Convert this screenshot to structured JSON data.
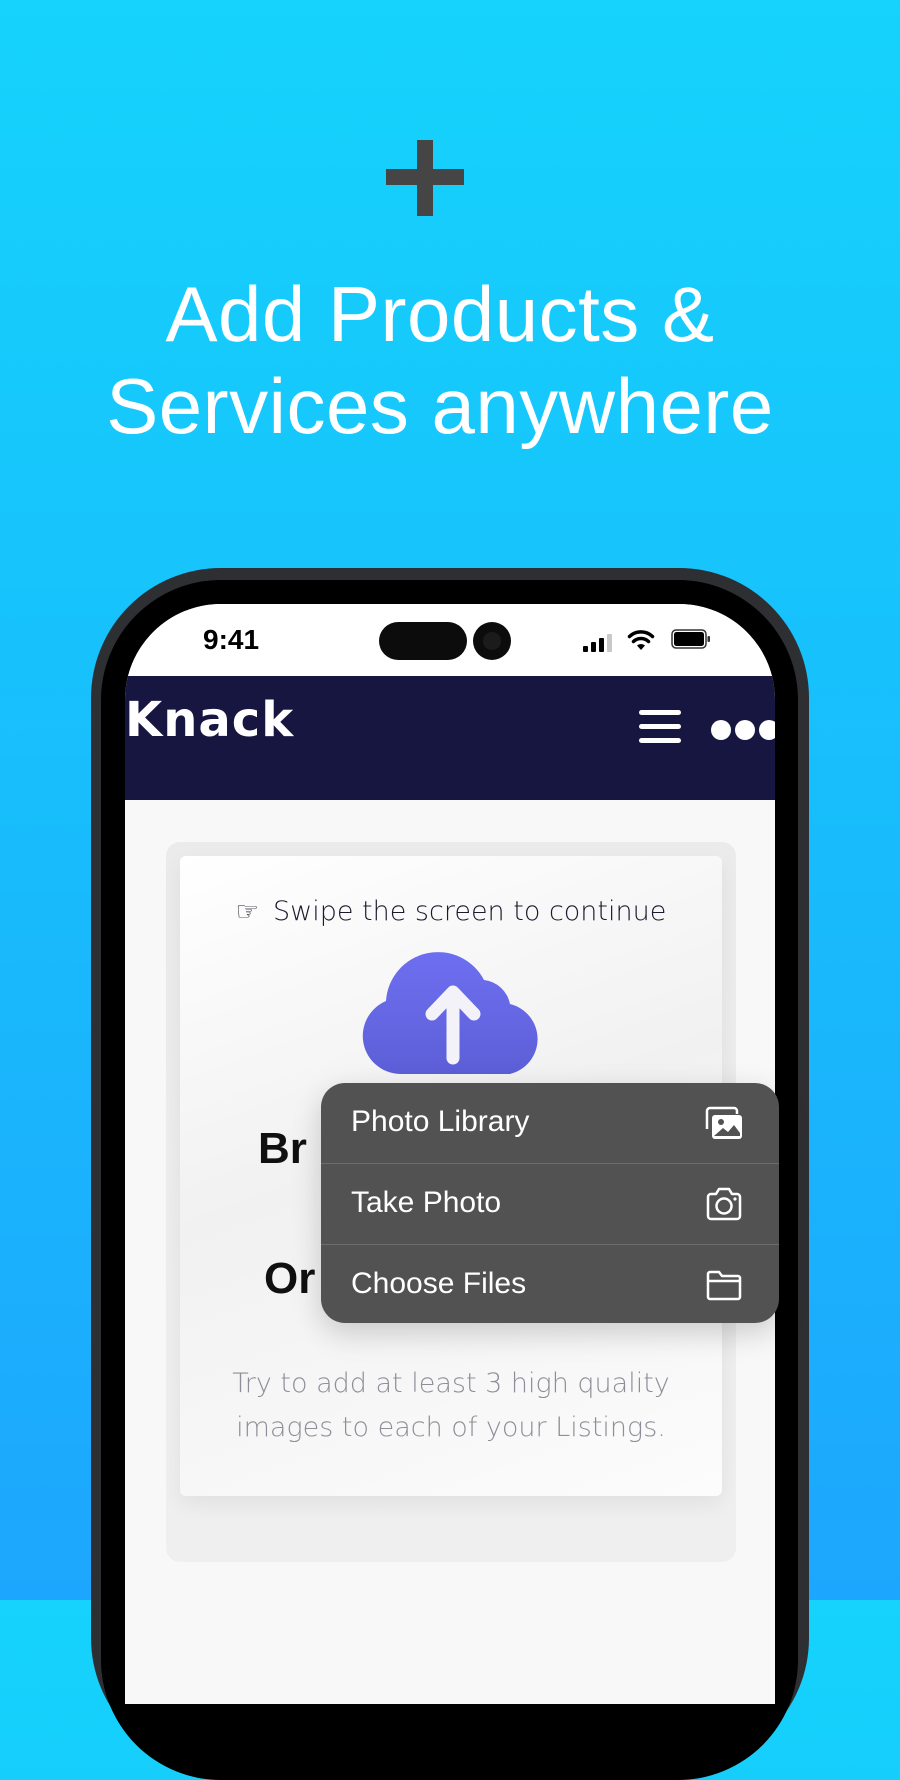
{
  "hero": {
    "icon": "plus-icon",
    "title_line1": "Add Products &",
    "title_line2": "Services anywhere"
  },
  "colors": {
    "background_top": "#15d3fc",
    "background_bottom": "#1da6fd",
    "header_bg": "#171640",
    "cloud": "#6366e8",
    "menu_bg": "#525252"
  },
  "status_bar": {
    "time": "9:41",
    "icons": [
      "cellular-signal-icon",
      "wifi-icon",
      "battery-icon"
    ]
  },
  "app_header": {
    "brand": "Knack",
    "menu_icon": "hamburger-menu-icon",
    "more_icon": "more-dots-icon"
  },
  "upload_card": {
    "swipe_hint": "Swipe the screen to continue",
    "swipe_icon": "pointing-hand-icon",
    "upload_icon": "cloud-upload-icon",
    "obscured_line1": "Br",
    "obscured_line2": "Or",
    "tip_line1": "Try to add at least 3 high quality",
    "tip_line2": "images to each of your Listings."
  },
  "picker_menu": {
    "items": [
      {
        "label": "Photo Library",
        "icon": "photo-library-icon"
      },
      {
        "label": "Take Photo",
        "icon": "camera-icon"
      },
      {
        "label": "Choose Files",
        "icon": "folder-icon"
      }
    ]
  }
}
